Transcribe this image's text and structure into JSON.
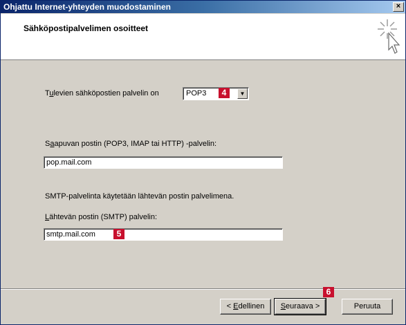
{
  "window": {
    "title": "Ohjattu Internet-yhteyden muodostaminen",
    "close_glyph": "×"
  },
  "header": {
    "title": "Sähköpostipalvelimen osoitteet",
    "icon": "wizard-star-cursor-icon"
  },
  "form": {
    "incoming_type_label_pre": "T",
    "incoming_type_label_u": "u",
    "incoming_type_label_post": "levien sähköpostien palvelin on",
    "incoming_type_value": "POP3",
    "incoming_server_label_pre": "S",
    "incoming_server_label_u": "a",
    "incoming_server_label_post": "apuvan postin (POP3, IMAP tai HTTP) -palvelin:",
    "incoming_server_value": "pop.mail.com",
    "smtp_note": "SMTP-palvelinta käytetään lähtevän postin palvelimena.",
    "outgoing_server_label_u": "L",
    "outgoing_server_label_post": "ähtevän postin (SMTP) palvelin:",
    "outgoing_server_value": "smtp.mail.com"
  },
  "badges": {
    "b4": "4",
    "b5": "5",
    "b6": "6"
  },
  "buttons": {
    "back_pre": "< ",
    "back_u": "E",
    "back_post": "dellinen",
    "next_u": "S",
    "next_post": "euraava >",
    "cancel": "Peruuta"
  },
  "colors": {
    "badge": "#c8102e",
    "background": "#d9e8f3",
    "dialog": "#d4d0c8"
  }
}
